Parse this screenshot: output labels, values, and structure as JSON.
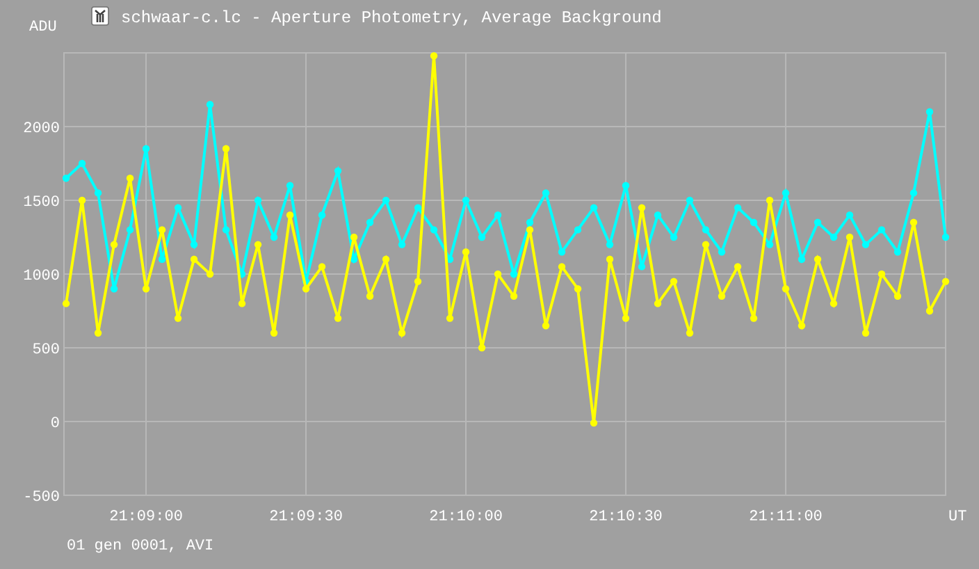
{
  "window": {
    "title": "schwaar-c.lc - Aperture Photometry, Average Background"
  },
  "chart": {
    "chart_data": {
      "type": "line",
      "xlabel": "UT",
      "ylabel": "ADU",
      "grid": true,
      "xlim": [
        76124.6,
        76290
      ],
      "ylim": [
        -500,
        2500
      ],
      "x": [
        76125,
        76128,
        76131,
        76134,
        76137,
        76140,
        76143,
        76146,
        76149,
        76152,
        76155,
        76158,
        76161,
        76164,
        76167,
        76170,
        76173,
        76176,
        76179,
        76182,
        76185,
        76188,
        76191,
        76194,
        76197,
        76200,
        76203,
        76206,
        76209,
        76212,
        76215,
        76218,
        76221,
        76224,
        76227,
        76230,
        76233,
        76236,
        76239,
        76242,
        76245,
        76248,
        76251,
        76254,
        76257,
        76260,
        76263,
        76266,
        76269,
        76272,
        76275,
        76278,
        76281,
        76284,
        76287,
        76290
      ],
      "xticks": [
        {
          "value": 76140,
          "label": "21:09:00"
        },
        {
          "value": 76170,
          "label": "21:09:30"
        },
        {
          "value": 76200,
          "label": "21:10:00"
        },
        {
          "value": 76230,
          "label": "21:10:30"
        },
        {
          "value": 76260,
          "label": "21:11:00"
        }
      ],
      "yticks": [
        -500,
        0,
        500,
        1000,
        1500,
        2000
      ],
      "series": [
        {
          "color": "#00ffff",
          "marker": "circle",
          "values": [
            1650,
            1750,
            1550,
            900,
            1300,
            1850,
            1100,
            1450,
            1200,
            2150,
            1300,
            1000,
            1500,
            1250,
            1600,
            950,
            1400,
            1700,
            1100,
            1350,
            1500,
            1200,
            1450,
            1300,
            1100,
            1500,
            1250,
            1400,
            1000,
            1350,
            1550,
            1150,
            1300,
            1450,
            1200,
            1600,
            1050,
            1400,
            1250,
            1500,
            1300,
            1150,
            1450,
            1350,
            1200,
            1550,
            1100,
            1350,
            1250,
            1400,
            1200,
            1300,
            1150,
            1550,
            2100,
            1250
          ]
        },
        {
          "color": "#ffff00",
          "marker": "circle",
          "values": [
            800,
            1500,
            600,
            1200,
            1650,
            900,
            1300,
            700,
            1100,
            1000,
            1850,
            800,
            1200,
            600,
            1400,
            900,
            1050,
            700,
            1250,
            850,
            1100,
            600,
            950,
            2480,
            700,
            1150,
            500,
            1000,
            850,
            1300,
            650,
            1050,
            900,
            -10,
            1100,
            700,
            1450,
            800,
            950,
            600,
            1200,
            850,
            1050,
            700,
            1500,
            900,
            650,
            1100,
            800,
            1250,
            600,
            1000,
            850,
            1350,
            750,
            950
          ]
        }
      ]
    }
  },
  "status_bar": {
    "text": "01 gen 0001, AVI"
  }
}
